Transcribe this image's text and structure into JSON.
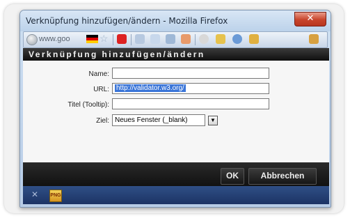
{
  "window": {
    "title": "Verknüpfung hinzufügen/ändern - Mozilla Firefox",
    "close_label": "✕"
  },
  "toolbar": {
    "url_text": "www.goo"
  },
  "dialog": {
    "heading": "Verknüpfung hinzufügen/ändern",
    "fields": {
      "name_label": "Name:",
      "name_value": "",
      "url_label": "URL:",
      "url_value": "http://validator.w3.org/",
      "title_label": "Titel (Tooltip):",
      "title_value": "",
      "target_label": "Ziel:",
      "target_value": "Neues Fenster (_blank)"
    },
    "ok_label": "OK",
    "cancel_label": "Abbrechen"
  },
  "statusbar": {
    "close_glyph": "✕"
  },
  "colors": {
    "header_bg": "#111111",
    "accent_selection": "#3a75d8",
    "statusbar": "#1c3364"
  }
}
